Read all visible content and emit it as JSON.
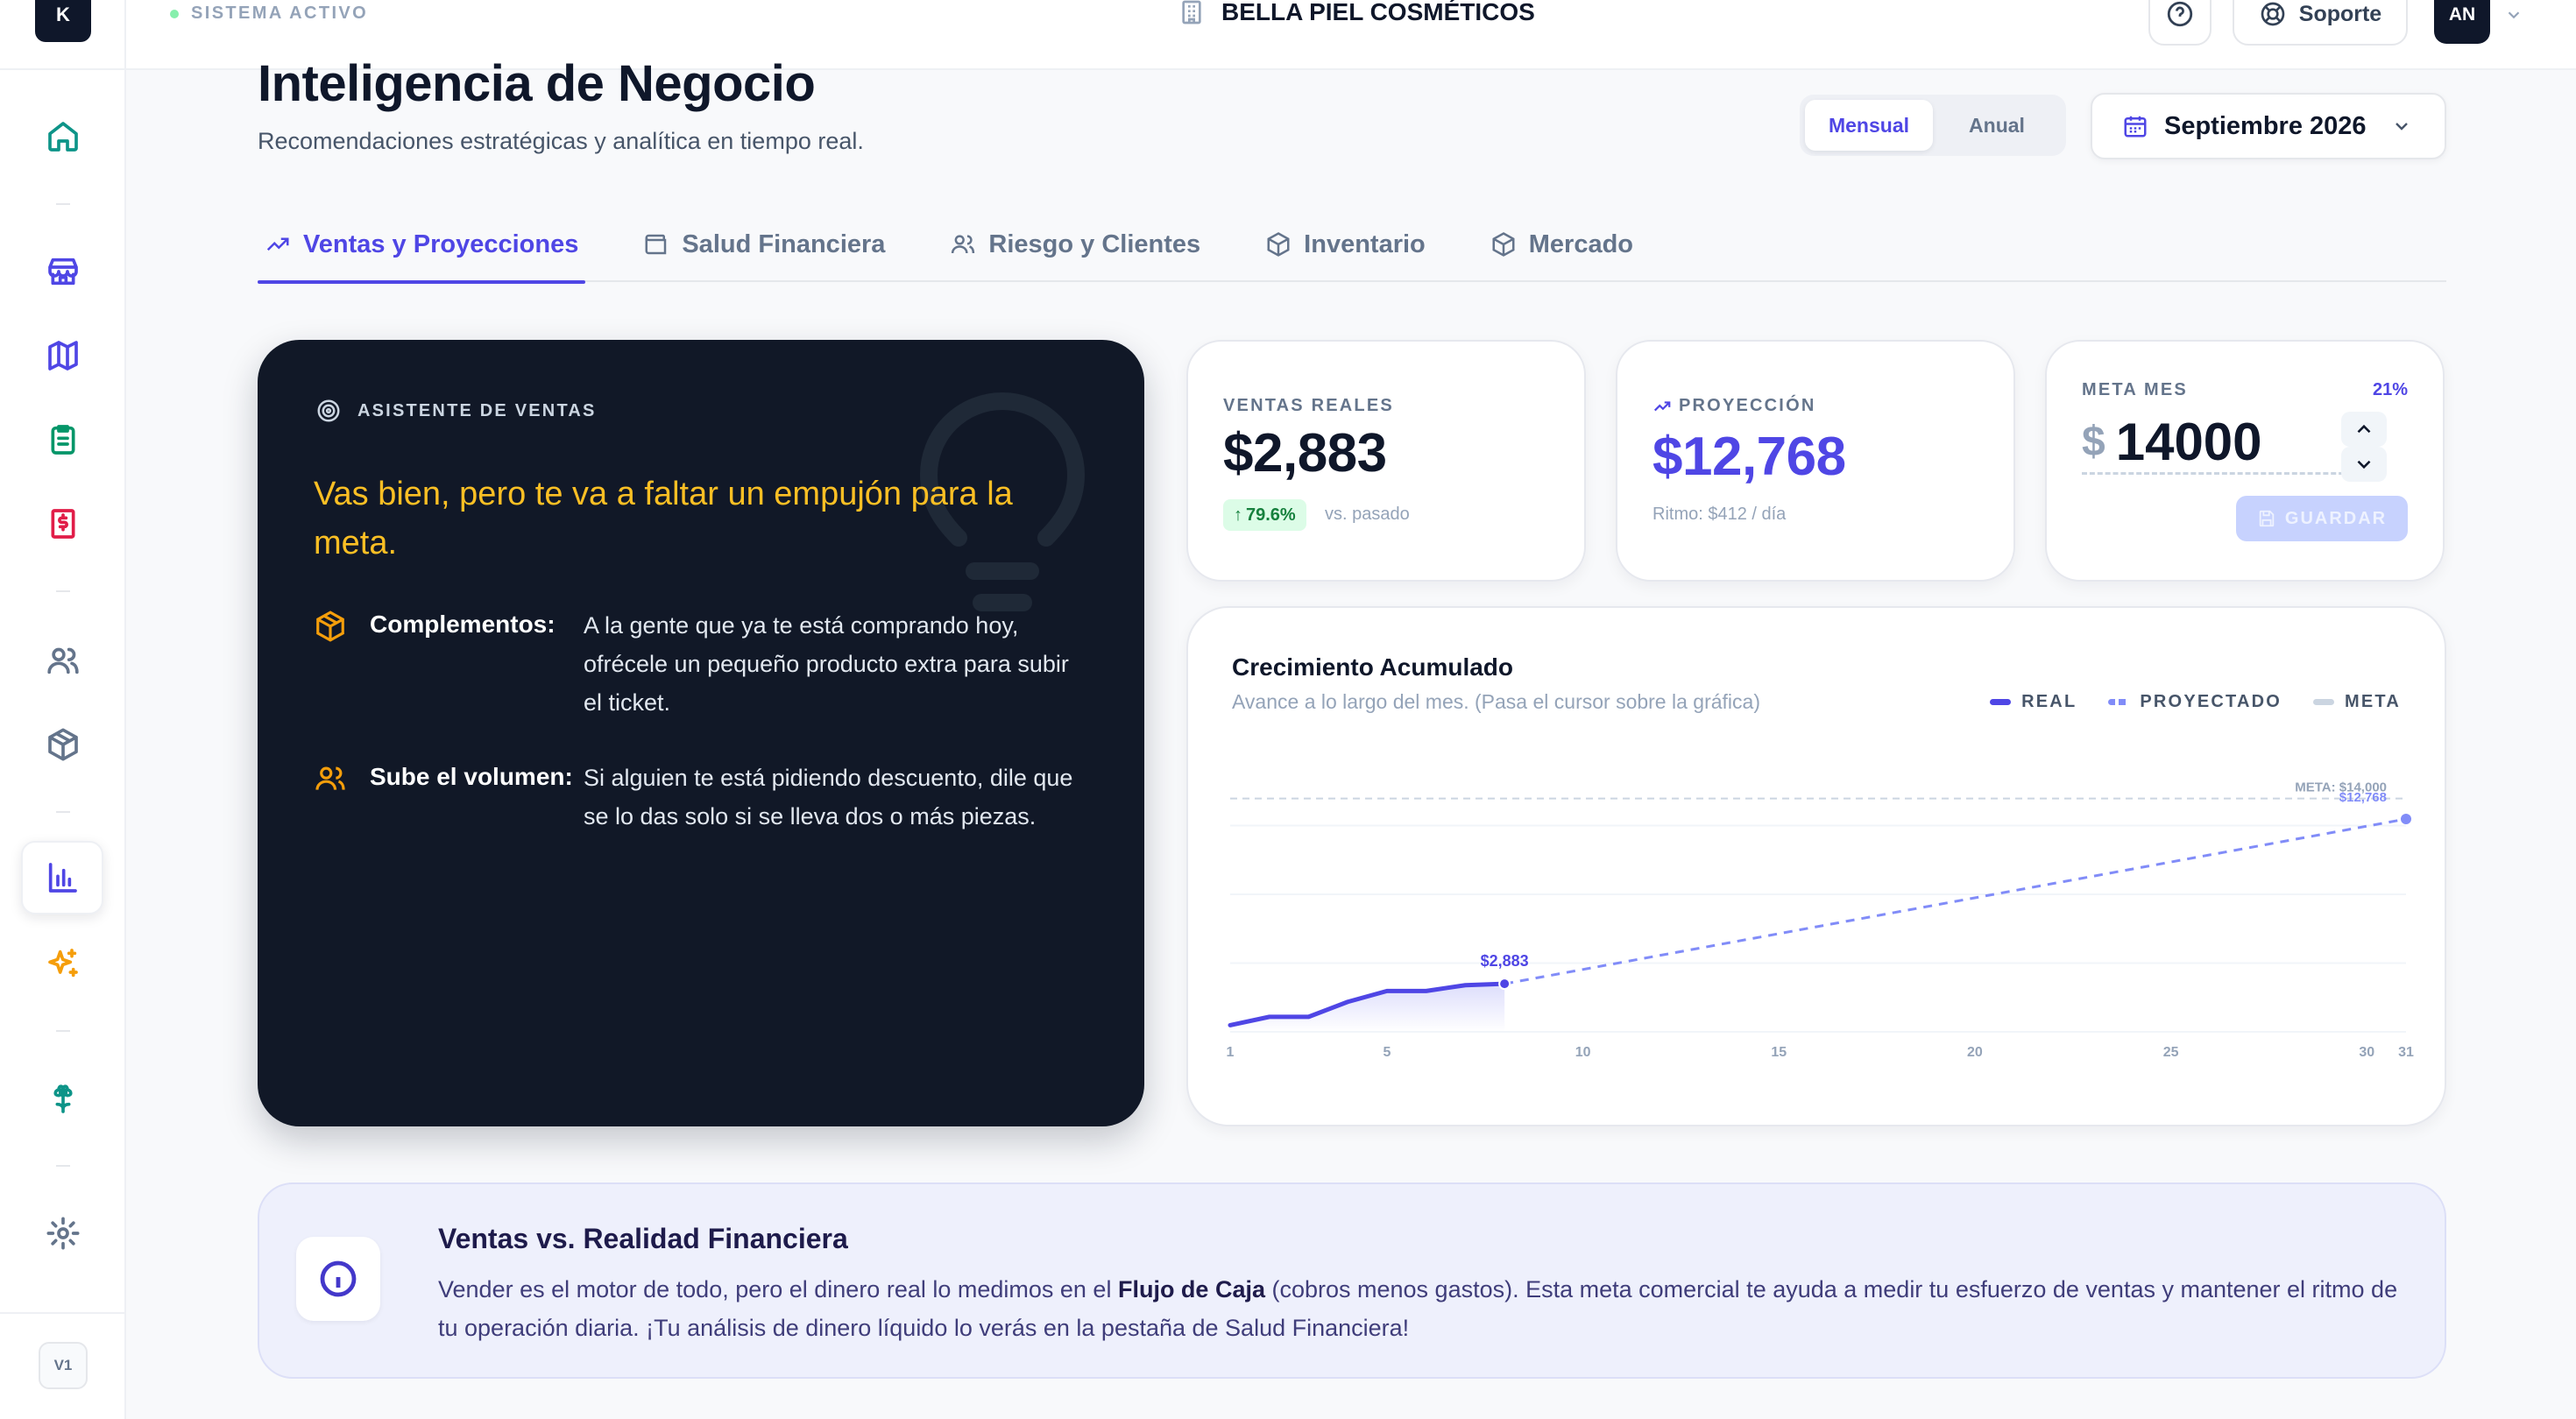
{
  "app": {
    "logo_letter": "K",
    "status": "SISTEMA ACTIVO",
    "brand_name": "BELLA PIEL COSMÉTICOS",
    "support_label": "Soporte",
    "avatar_initials": "AN",
    "version": "V1"
  },
  "sidebar": {
    "items": [
      {
        "icon": "home-icon",
        "color": "#0d9488"
      },
      {
        "icon": "store-icon",
        "color": "#4f46e5"
      },
      {
        "icon": "map-icon",
        "color": "#4f46e5"
      },
      {
        "icon": "clipboard-icon",
        "color": "#059669"
      },
      {
        "icon": "invoice-dollar-icon",
        "color": "#e11d48"
      },
      {
        "icon": "users-icon",
        "color": "#64748b"
      },
      {
        "icon": "box-icon",
        "color": "#64748b"
      },
      {
        "icon": "bar-chart-icon",
        "color": "#4f46e5",
        "active": true
      },
      {
        "icon": "sparkles-icon",
        "color": "#f59e0b"
      },
      {
        "icon": "flower-icon",
        "color": "#0d9488"
      },
      {
        "icon": "gear-icon",
        "color": "#64748b"
      }
    ]
  },
  "header": {
    "title": "Inteligencia de Negocio",
    "subtitle": "Recomendaciones estratégicas y analítica en tiempo real.",
    "period_options": [
      "Mensual",
      "Anual"
    ],
    "period_selected": "Mensual",
    "date_label": "Septiembre 2026"
  },
  "tabs": [
    {
      "label": "Ventas y Proyecciones",
      "icon": "trending-up-icon",
      "active": true
    },
    {
      "label": "Salud Financiera",
      "icon": "wallet-icon"
    },
    {
      "label": "Riesgo y Clientes",
      "icon": "users-icon"
    },
    {
      "label": "Inventario",
      "icon": "box-icon"
    },
    {
      "label": "Mercado",
      "icon": "box-icon"
    }
  ],
  "assistant": {
    "label": "ASISTENTE DE VENTAS",
    "message": "Vas bien, pero te va a faltar un empujón para la meta.",
    "tips": [
      {
        "label": "Complementos:",
        "icon": "box-icon",
        "text": "A la gente que ya te está comprando hoy, ofrécele un pequeño producto extra para subir el ticket."
      },
      {
        "label": "Sube el volumen:",
        "icon": "users-icon",
        "text": "Si alguien te está pidiendo descuento, dile que se lo das solo si se lleva dos o más piezas."
      }
    ]
  },
  "kpis": {
    "sales": {
      "label": "VENTAS REALES",
      "value": "$2,883",
      "change": "79.6%",
      "change_note": "vs. pasado"
    },
    "projection": {
      "label": "PROYECCIÓN",
      "value": "$12,768",
      "note": "Ritmo: $412 / día",
      "color": "#4f46e5"
    },
    "goal": {
      "label": "META MES",
      "percent": "21%",
      "currency": "$",
      "value": "14000",
      "save_label": "GUARDAR"
    }
  },
  "chart": {
    "title": "Crecimiento Acumulado",
    "subtitle": "Avance a lo largo del mes. (Pasa el cursor sobre la gráfica)",
    "legend": [
      {
        "label": "REAL",
        "color": "#4f46e5"
      },
      {
        "label": "PROYECTADO",
        "color": "#818cf8"
      },
      {
        "label": "META",
        "color": "#cbd5e1"
      }
    ],
    "meta_label": "META: $14,000",
    "projection_label": "$12,768",
    "current_label": "$2,883"
  },
  "chart_data": {
    "type": "line",
    "x_ticks": [
      1,
      5,
      10,
      15,
      20,
      25,
      30,
      31
    ],
    "xlim": [
      1,
      31
    ],
    "ylim": [
      0,
      16500
    ],
    "grid": true,
    "series": [
      {
        "name": "REAL",
        "x": [
          1,
          2,
          3,
          4,
          5,
          6,
          7,
          8
        ],
        "y": [
          400,
          900,
          900,
          1800,
          2450,
          2450,
          2800,
          2883
        ]
      },
      {
        "name": "PROYECTADO",
        "x": [
          8,
          31
        ],
        "y": [
          2883,
          12768
        ]
      },
      {
        "name": "META",
        "x": [
          1,
          31
        ],
        "y": [
          14000,
          14000
        ]
      }
    ]
  },
  "info": {
    "title": "Ventas vs. Realidad Financiera",
    "text_before": "Vender es el motor de todo, pero el dinero real lo medimos en el ",
    "text_bold": "Flujo de Caja",
    "text_after": " (cobros menos gastos). Esta meta comercial te ayuda a medir tu esfuerzo de ventas y mantener el ritmo de tu operación diaria. ¡Tu análisis de dinero líquido lo verás en la pestaña de Salud Financiera!"
  }
}
